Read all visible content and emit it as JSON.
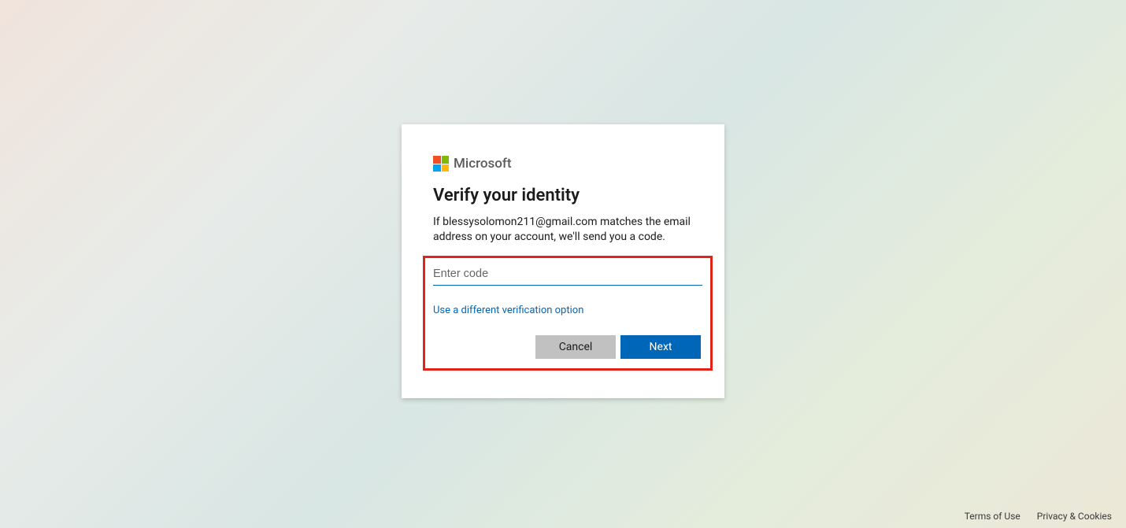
{
  "brand": {
    "name": "Microsoft"
  },
  "card": {
    "title": "Verify your identity",
    "description": "If blessysolomon211@gmail.com matches the email address on your account, we'll send you a code.",
    "code_placeholder": "Enter code",
    "code_value": "",
    "alt_option_label": "Use a different verification option",
    "cancel_label": "Cancel",
    "next_label": "Next"
  },
  "footer": {
    "terms_label": "Terms of Use",
    "privacy_label": "Privacy & Cookies"
  }
}
